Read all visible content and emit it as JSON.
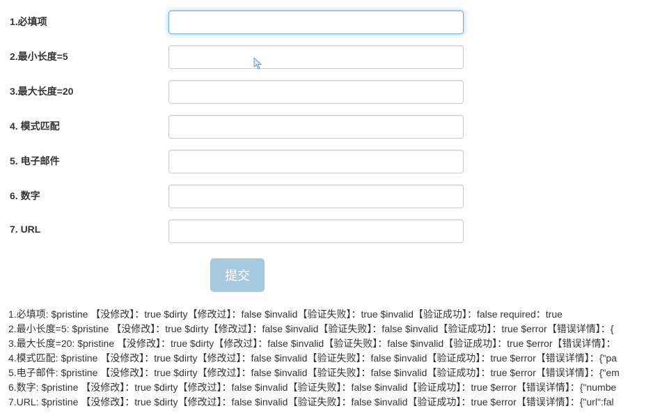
{
  "form": {
    "fields": [
      {
        "label": "1.必填项",
        "value": "",
        "focused": true
      },
      {
        "label": "2.最小长度=5",
        "value": "",
        "focused": false
      },
      {
        "label": "3.最大长度=20",
        "value": "",
        "focused": false
      },
      {
        "label": "4. 模式匹配",
        "value": "",
        "focused": false
      },
      {
        "label": "5. 电子邮件",
        "value": "",
        "focused": false
      },
      {
        "label": "6. 数字",
        "value": "",
        "focused": false
      },
      {
        "label": "7. URL",
        "value": "",
        "focused": false
      }
    ],
    "submit_label": "提交"
  },
  "status": [
    "1.必填项:   $pristine 【没修改】：true   $dirty【修改过】：false   $invalid【验证失败】：true   $invalid【验证成功】：false   required：true",
    "2.最小长度=5: $pristine 【没修改】：true   $dirty【修改过】：false   $invalid【验证失败】：false   $invalid【验证成功】：true   $error【错误详情】：{",
    "3.最大长度=20: $pristine 【没修改】：true   $dirty【修改过】：false   $invalid【验证失败】：false   $invalid【验证成功】：true   $error【错误详情】：",
    "4.模式匹配: $pristine 【没修改】：true   $dirty【修改过】：false   $invalid【验证失败】：false   $invalid【验证成功】：true   $error【错误详情】：{\"pa",
    "5.电子邮件: $pristine 【没修改】：true   $dirty【修改过】：false   $invalid【验证失败】：false   $invalid【验证成功】：true   $error【错误详情】：{\"em",
    "6.数字: $pristine 【没修改】：true   $dirty【修改过】：false   $invalid【验证失败】：false   $invalid【验证成功】：true   $error【错误详情】：{\"numbe",
    "7.URL: $pristine 【没修改】：true   $dirty【修改过】：false   $invalid【验证失败】：false   $invalid【验证成功】：true   $error【错误详情】：{\"url\":fal"
  ]
}
